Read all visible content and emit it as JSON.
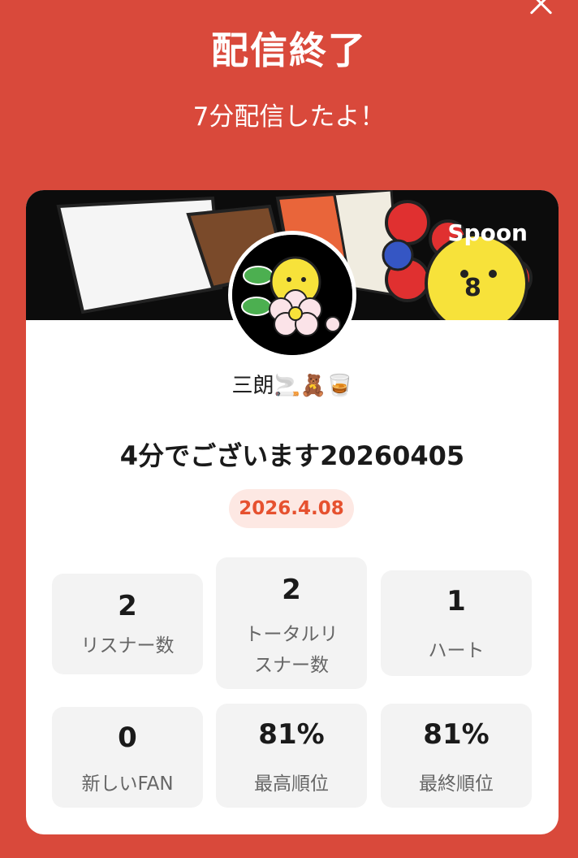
{
  "header": {
    "title": "配信終了",
    "subtitle": "7分配信したよ！"
  },
  "card": {
    "brand": "Spoon",
    "username": "三朗🚬🧸🥃",
    "stream_title": "4分でございます20260405",
    "date": "2026.4.08"
  },
  "stats": [
    {
      "value": "2",
      "label": "リスナー数"
    },
    {
      "value": "2",
      "label_line1": "トータルリ",
      "label_line2": "スナー数"
    },
    {
      "value": "1",
      "label": "ハート"
    },
    {
      "value": "0",
      "label": "新しいFAN"
    },
    {
      "value": "81%",
      "label": "最高順位"
    },
    {
      "value": "81%",
      "label": "最終順位"
    }
  ],
  "colors": {
    "background": "#d9493b",
    "card": "#ffffff",
    "badge_bg": "#fde8e3",
    "badge_text": "#e6512f",
    "stat_bg": "#f3f3f3"
  },
  "icons": [
    "close-icon",
    "avatar-character-icon"
  ]
}
